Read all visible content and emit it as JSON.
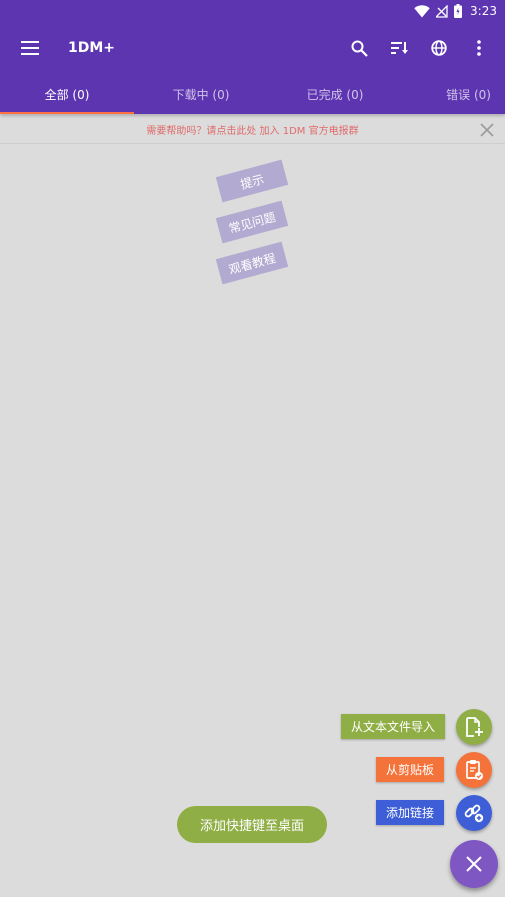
{
  "status_bar": {
    "time": "3:23"
  },
  "app_bar": {
    "title": "1DM+"
  },
  "tabs": [
    {
      "label": "全部 (0)"
    },
    {
      "label": "下载中 (0)"
    },
    {
      "label": "已完成 (0)"
    },
    {
      "label": "错误 (0)"
    }
  ],
  "banner": {
    "text": "需要帮助吗？请点击此处 加入 1DM 官方电报群"
  },
  "hints": [
    {
      "label": "提示"
    },
    {
      "label": "常见问题"
    },
    {
      "label": "观看教程"
    }
  ],
  "fab_menu": {
    "import_label": "从文本文件导入",
    "clipboard_label": "从剪贴板",
    "add_link_label": "添加链接"
  },
  "shortcut": {
    "label": "添加快捷键至桌面"
  },
  "colors": {
    "primary": "#5e35b1",
    "tab_indicator": "#ff7043",
    "import_green": "#8fae45",
    "clipboard_orange": "#f4733a",
    "link_blue": "#3d5ed6",
    "main_fab": "#7e57c2"
  },
  "icons": {
    "wifi": "wifi-icon",
    "signal": "signal-icon",
    "battery": "battery-icon",
    "menu": "menu-icon",
    "search": "search-icon",
    "sort": "sort-icon",
    "browser": "globe-icon",
    "more": "more-vert-icon",
    "close": "close-icon",
    "file_add": "file-add-icon",
    "clipboard": "clipboard-icon",
    "link": "link-icon",
    "fab_close": "close-icon"
  }
}
